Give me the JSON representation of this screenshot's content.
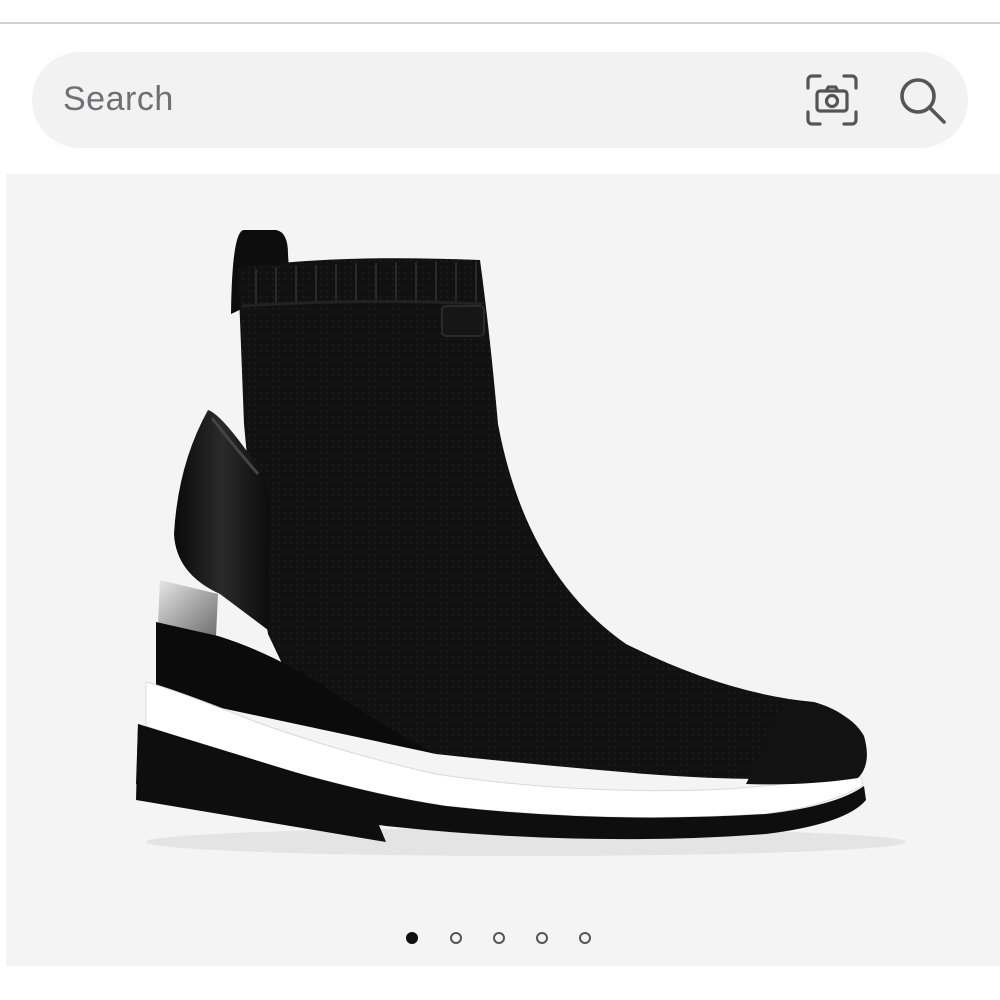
{
  "search": {
    "placeholder": "Search",
    "camera_icon": "camera-icon",
    "search_icon": "search-icon"
  },
  "product_image": {
    "subject": "shoe-image",
    "background": "#f4f4f4"
  },
  "pager": {
    "count": 5,
    "active_index": 0
  }
}
